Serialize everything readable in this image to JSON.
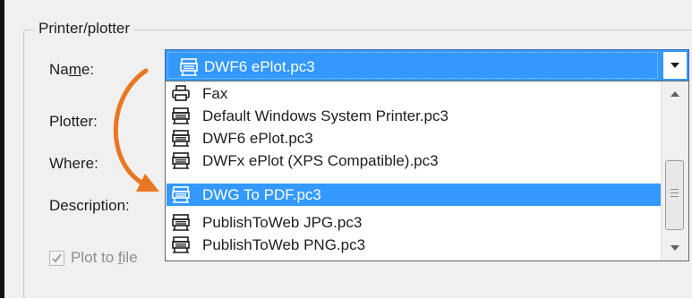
{
  "group": {
    "title": "Printer/plotter"
  },
  "labels": {
    "name_pre": "Na",
    "name_u": "m",
    "name_post": "e:",
    "plotter": "Plotter:",
    "where": "Where:",
    "description": "Description:"
  },
  "name_combo": {
    "value": "DWF6 ePlot.pc3",
    "icon": "plotter-icon"
  },
  "dropdown": {
    "selected_index": 4,
    "items": [
      {
        "label": "Fax",
        "icon": "fax-icon"
      },
      {
        "label": "Default Windows System Printer.pc3",
        "icon": "plotter-icon"
      },
      {
        "label": "DWF6 ePlot.pc3",
        "icon": "plotter-icon"
      },
      {
        "label": "DWFx ePlot (XPS Compatible).pc3",
        "icon": "plotter-icon"
      },
      {
        "label": "DWG To PDF.pc3",
        "icon": "plotter-icon"
      },
      {
        "label": "PublishToWeb JPG.pc3",
        "icon": "plotter-icon"
      },
      {
        "label": "PublishToWeb PNG.pc3",
        "icon": "plotter-icon"
      }
    ]
  },
  "plot_to_file": {
    "label_pre": "Plot to ",
    "label_u": "f",
    "label_post": "ile",
    "checked": true,
    "enabled": false
  },
  "colors": {
    "selection": "#3399ff",
    "annotation_arrow": "#e87722"
  }
}
